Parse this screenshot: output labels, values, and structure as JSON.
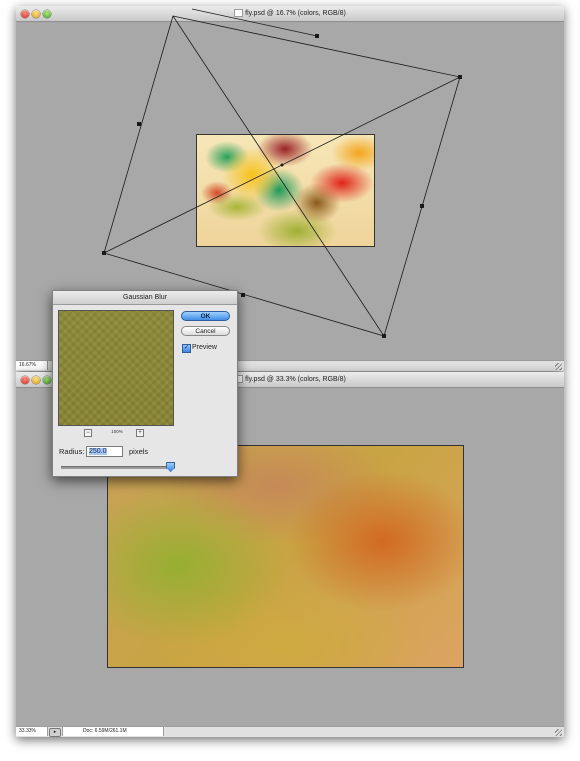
{
  "windows": {
    "top": {
      "title": "fly.psd @ 16.7% (colors, RGB/8)",
      "zoom": "16.67%"
    },
    "bottom": {
      "title": "fly.psd @ 33.3% (colors, RGB/8)",
      "zoom": "33.33%",
      "doc_info": "Doc: 6.59M/261.1M",
      "status_arrow": "▸"
    }
  },
  "dialog": {
    "title": "Gaussian Blur",
    "ok_label": "OK",
    "cancel_label": "Cancel",
    "preview_label": "Preview",
    "preview_checked": true,
    "check_glyph": "✓",
    "zoom_level": "100%",
    "zoom_out_glyph": "−",
    "zoom_in_glyph": "+",
    "radius_label": "Radius:",
    "radius_value": "250.0",
    "radius_units": "pixels",
    "radius_slider_fraction": 0.97
  },
  "colors": {
    "workspace": "#a8a8a8",
    "ok_button": "#3f8fe4",
    "preview_swatch": "#8c8836"
  },
  "icons": [
    "close-icon",
    "minimize-icon",
    "zoom-icon",
    "document-icon",
    "resize-grip-icon",
    "checkbox-icon",
    "zoom-out-icon",
    "zoom-in-icon"
  ]
}
